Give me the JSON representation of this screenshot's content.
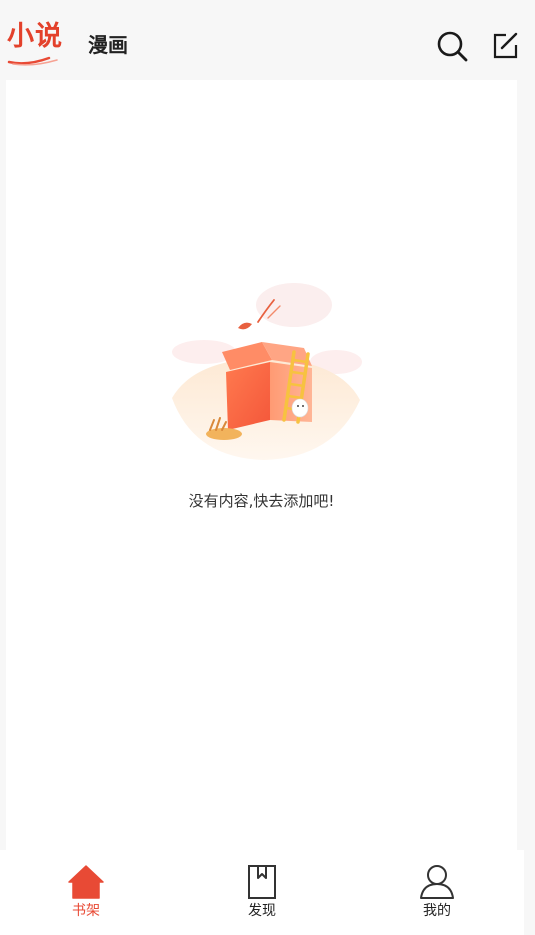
{
  "header": {
    "tabs": [
      {
        "label": "小说",
        "active": true
      },
      {
        "label": "漫画",
        "active": false
      }
    ],
    "icons": [
      "search-icon",
      "edit-icon"
    ]
  },
  "main": {
    "empty_message": "没有内容,快去添加吧!",
    "illustration": "empty-box-illustration"
  },
  "bottom_nav": {
    "items": [
      {
        "label": "书架",
        "icon": "home-icon",
        "active": true
      },
      {
        "label": "发现",
        "icon": "book-icon",
        "active": false
      },
      {
        "label": "我的",
        "icon": "user-icon",
        "active": false
      }
    ]
  },
  "colors": {
    "accent": "#e84a35",
    "background": "#f7f7f7",
    "panel": "#ffffff"
  }
}
